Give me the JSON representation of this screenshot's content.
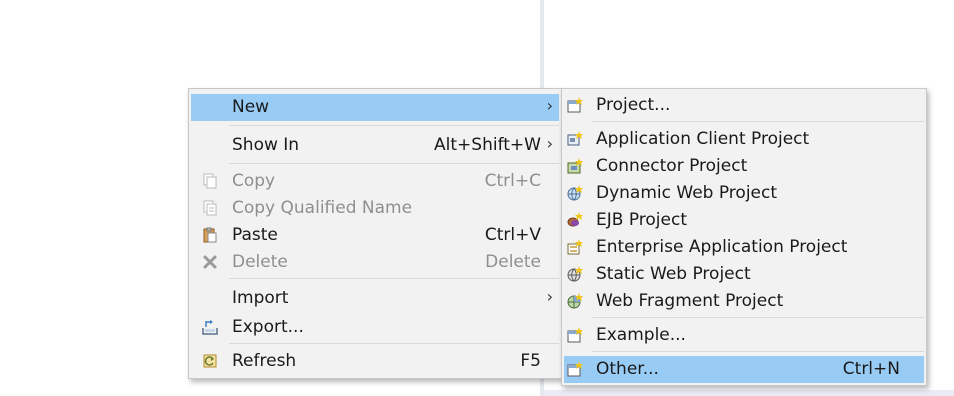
{
  "context_menu": {
    "new": {
      "label": "New"
    },
    "show_in": {
      "label": "Show In",
      "shortcut": "Alt+Shift+W"
    },
    "copy": {
      "label": "Copy",
      "shortcut": "Ctrl+C"
    },
    "copy_qualified": {
      "label": "Copy Qualified Name"
    },
    "paste": {
      "label": "Paste",
      "shortcut": "Ctrl+V"
    },
    "delete": {
      "label": "Delete",
      "shortcut": "Delete"
    },
    "import": {
      "label": "Import"
    },
    "export": {
      "label": "Export..."
    },
    "refresh": {
      "label": "Refresh",
      "shortcut": "F5"
    }
  },
  "new_submenu": {
    "project": {
      "label": "Project..."
    },
    "app_client": {
      "label": "Application Client Project"
    },
    "connector": {
      "label": "Connector Project"
    },
    "dynamic_web": {
      "label": "Dynamic Web Project"
    },
    "ejb": {
      "label": "EJB Project"
    },
    "enterprise_app": {
      "label": "Enterprise Application Project"
    },
    "static_web": {
      "label": "Static Web Project"
    },
    "web_fragment": {
      "label": "Web Fragment Project"
    },
    "example": {
      "label": "Example..."
    },
    "other": {
      "label": "Other...",
      "shortcut": "Ctrl+N"
    }
  },
  "colors": {
    "highlight": "#99ccf5",
    "menu_background": "#f2f2f2",
    "disabled_text": "#8f8f8f"
  }
}
